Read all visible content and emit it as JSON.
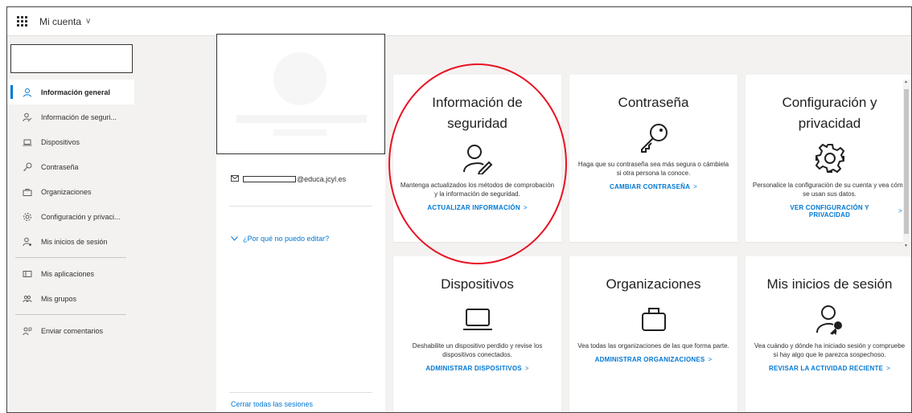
{
  "header": {
    "app_title": "Mi cuenta",
    "chevron": "∨"
  },
  "sidebar": {
    "items": [
      {
        "label": "Información general",
        "icon": "person-icon",
        "active": true
      },
      {
        "label": "Información de seguri...",
        "icon": "person-key-icon"
      },
      {
        "label": "Dispositivos",
        "icon": "laptop-icon"
      },
      {
        "label": "Contraseña",
        "icon": "key-icon"
      },
      {
        "label": "Organizaciones",
        "icon": "briefcase-icon"
      },
      {
        "label": "Configuración y privaci...",
        "icon": "gear-icon"
      },
      {
        "label": "Mis inicios de sesión",
        "icon": "person-signin-icon"
      },
      {
        "label": "Mis aplicaciones",
        "icon": "apps-icon"
      },
      {
        "label": "Mis grupos",
        "icon": "groups-icon"
      },
      {
        "label": "Enviar comentarios",
        "icon": "feedback-icon"
      }
    ]
  },
  "profile": {
    "email_suffix": "@educa.jcyl.es",
    "why_cant_edit": "¿Por qué no puedo editar?",
    "sign_out_all": "Cerrar todas las sesiones"
  },
  "tiles": [
    {
      "title": "Información de seguridad",
      "icon": "person-edit-icon",
      "description": "Mantenga actualizados los métodos de comprobación y la información de seguridad.",
      "link": "ACTUALIZAR INFORMACIÓN"
    },
    {
      "title": "Contraseña",
      "icon": "key-icon",
      "description": "Haga que su contraseña sea más segura o cámbiela si otra persona la conoce.",
      "link": "CAMBIAR CONTRASEÑA"
    },
    {
      "title": "Configuración y privacidad",
      "icon": "gear-icon",
      "description": "Personalice la configuración de su cuenta y vea cómo se usan sus datos.",
      "link": "VER CONFIGURACIÓN Y PRIVACIDAD"
    },
    {
      "title": "Dispositivos",
      "icon": "laptop-icon",
      "description": "Deshabilite un dispositivo perdido y revise los dispositivos conectados.",
      "link": "ADMINISTRAR DISPOSITIVOS"
    },
    {
      "title": "Organizaciones",
      "icon": "briefcase-icon",
      "description": "Vea todas las organizaciones de las que forma parte.",
      "link": "ADMINISTRAR ORGANIZACIONES"
    },
    {
      "title": "Mis inicios de sesión",
      "icon": "person-key-icon",
      "description": "Vea cuándo y dónde ha iniciado sesión y compruebe si hay algo que le parezca sospechoso.",
      "link": "REVISAR LA ACTIVIDAD RECIENTE"
    }
  ],
  "colors": {
    "accent": "#0078d4",
    "annotation": "#e81123",
    "background": "#f3f2f1"
  },
  "link_chevron": ">"
}
